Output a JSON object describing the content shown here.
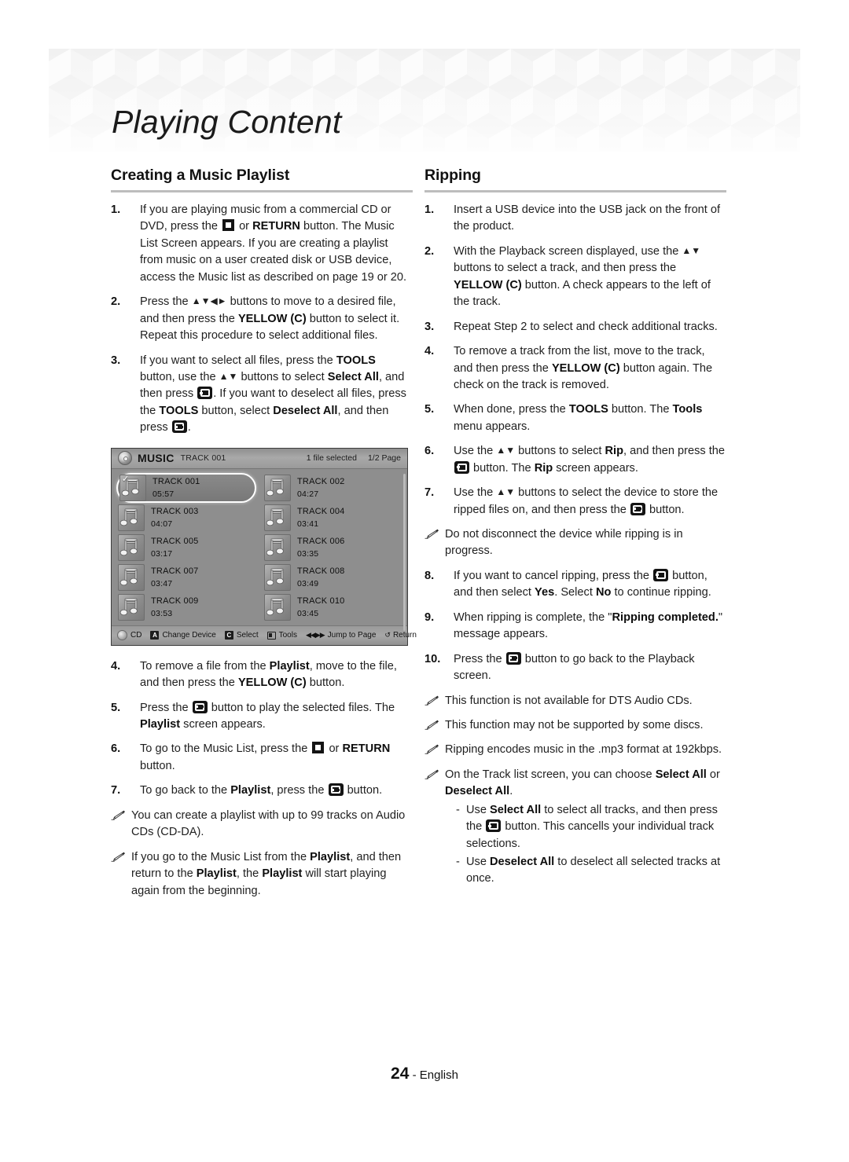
{
  "header": {
    "chapter_title": "Playing Content"
  },
  "left_column": {
    "section_title": "Creating a Music Playlist",
    "steps": [
      {
        "num": "1.",
        "html": "If you are playing music from a commercial CD or DVD, press the <span class=\"key-stop\" data-name=\"stop-key-icon\" data-interactable=\"false\"></span> or <b>RETURN</b> button. The Music List Screen appears. If you are creating a playlist from music on a user created disk or USB device, access the Music list as described on page 19 or 20."
      },
      {
        "num": "2.",
        "html": "Press the <span class=\"arrows\">&#9650;&#9660;&#9664;&#9658;</span> buttons to move to a desired file, and then press the <b>YELLOW (C)</b> button to select it. Repeat this procedure to select additional files."
      },
      {
        "num": "3.",
        "html": "If you want to select all files, press the <b>TOOLS</b> button, use the <span class=\"arrows\">&#9650;&#9660;</span> buttons to select <b>Select All</b>, and then press <span class=\"key-enter\" data-name=\"enter-key-icon\" data-interactable=\"false\"></span>. If you want to deselect all files, press the <b>TOOLS</b> button, select <b>Deselect All</b>, and then press <span class=\"key-enter\" data-name=\"enter-key-icon\" data-interactable=\"false\"></span>."
      }
    ],
    "steps_after": [
      {
        "num": "4.",
        "html": "To remove a file from the <b>Playlist</b>, move to the file, and then press the <b>YELLOW (C)</b> button."
      },
      {
        "num": "5.",
        "html": "Press the <span class=\"key-enter\" data-name=\"enter-key-icon\" data-interactable=\"false\"></span> button to play the selected files. The <b>Playlist</b> screen appears."
      },
      {
        "num": "6.",
        "html": "To go to the Music List, press the <span class=\"key-stop\" data-name=\"stop-key-icon\" data-interactable=\"false\"></span> or <b>RETURN</b> button."
      },
      {
        "num": "7.",
        "html": "To go back to the <b>Playlist</b>, press the <span class=\"key-enter\" data-name=\"enter-key-icon\" data-interactable=\"false\"></span> button."
      }
    ],
    "notes": [
      {
        "html": "You can create a playlist with up to 99 tracks on Audio CDs (CD-DA)."
      },
      {
        "html": "If you go to the Music List from the <b>Playlist</b>, and then return to the <b>Playlist</b>, the <b>Playlist</b> will start playing again from the beginning."
      }
    ]
  },
  "screen": {
    "disc_icon": "disc-icon",
    "title": "MUSIC",
    "subtitle": "TRACK 001",
    "selected_count": "1 file selected",
    "page_indicator": "1/2 Page",
    "tracks": [
      {
        "name": "TRACK 001",
        "time": "05:57",
        "selected": true,
        "checked": true
      },
      {
        "name": "TRACK 002",
        "time": "04:27",
        "selected": false,
        "checked": false
      },
      {
        "name": "TRACK 003",
        "time": "04:07",
        "selected": false,
        "checked": false
      },
      {
        "name": "TRACK 004",
        "time": "03:41",
        "selected": false,
        "checked": false
      },
      {
        "name": "TRACK 005",
        "time": "03:17",
        "selected": false,
        "checked": false
      },
      {
        "name": "TRACK 006",
        "time": "03:35",
        "selected": false,
        "checked": false
      },
      {
        "name": "TRACK 007",
        "time": "03:47",
        "selected": false,
        "checked": false
      },
      {
        "name": "TRACK 008",
        "time": "03:49",
        "selected": false,
        "checked": false
      },
      {
        "name": "TRACK 009",
        "time": "03:53",
        "selected": false,
        "checked": false
      },
      {
        "name": "TRACK 010",
        "time": "03:45",
        "selected": false,
        "checked": false
      }
    ],
    "footer_items": [
      {
        "icon": "disc-icon",
        "badge": "",
        "label": "CD"
      },
      {
        "icon": "red-a-key-icon",
        "badge": "A",
        "label": "Change Device"
      },
      {
        "icon": "yellow-c-key-icon",
        "badge": "C",
        "label": "Select"
      },
      {
        "icon": "tools-key-icon",
        "badge": "",
        "label": "Tools"
      },
      {
        "icon": "skip-keys-icon",
        "badge": "",
        "label": "Jump to Page"
      },
      {
        "icon": "return-key-icon",
        "badge": "",
        "label": "Return"
      }
    ]
  },
  "right_column": {
    "section_title": "Ripping",
    "steps": [
      {
        "num": "1.",
        "html": "Insert a USB device into the USB jack on the front of the product."
      },
      {
        "num": "2.",
        "html": "With the Playback screen displayed, use the <span class=\"arrows\">&#9650;&#9660;</span> buttons to select a track, and then press the <b>YELLOW (C)</b> button. A check appears to the left of the track."
      },
      {
        "num": "3.",
        "html": "Repeat Step 2 to select and check additional tracks."
      },
      {
        "num": "4.",
        "html": "To remove a track from the list, move to the track, and then press the <b>YELLOW (C)</b> button again. The check on the track is removed."
      },
      {
        "num": "5.",
        "html": "When done, press the <b>TOOLS</b> button. The <b>Tools</b> menu appears."
      },
      {
        "num": "6.",
        "html": "Use the <span class=\"arrows\">&#9650;&#9660;</span> buttons to select <b>Rip</b>, and then press the <span class=\"key-enter\" data-name=\"enter-key-icon\" data-interactable=\"false\"></span> button. The <b>Rip</b> screen appears."
      },
      {
        "num": "7.",
        "html": "Use the <span class=\"arrows\">&#9650;&#9660;</span> buttons to select the device to store the ripped files on, and then press the <span class=\"key-enter\" data-name=\"enter-key-icon\" data-interactable=\"false\"></span> button."
      }
    ],
    "mid_note": {
      "html": "Do not disconnect the device while ripping is in progress."
    },
    "steps2": [
      {
        "num": "8.",
        "html": "If you want to cancel ripping, press the <span class=\"key-enter\" data-name=\"enter-key-icon\" data-interactable=\"false\"></span> button, and then select <b>Yes</b>. Select <b>No</b> to continue ripping."
      },
      {
        "num": "9.",
        "html": "When ripping is complete, the \"<b>Ripping completed.</b>\" message appears."
      },
      {
        "num": "10.",
        "html": "Press the <span class=\"key-enter\" data-name=\"enter-key-icon\" data-interactable=\"false\"></span> button to go back to the Playback screen."
      }
    ],
    "notes": [
      {
        "html": "This function is not available for DTS Audio CDs.",
        "subs": []
      },
      {
        "html": "This function may not be supported by some discs.",
        "subs": []
      },
      {
        "html": "Ripping encodes music in the .mp3 format at 192kbps.",
        "subs": []
      },
      {
        "html": "On the Track list screen, you can choose <b>Select All</b> or <b>Deselect All</b>.",
        "subs": [
          {
            "dash": "-",
            "html": "Use <b>Select All</b> to select all tracks, and then press the <span class=\"key-enter\" data-name=\"enter-key-icon\" data-interactable=\"false\"></span> button. This cancells your individual track selections."
          },
          {
            "dash": "-",
            "html": "Use <b>Deselect All</b> to deselect all selected tracks at once."
          }
        ]
      }
    ]
  },
  "footer": {
    "page_number": "24",
    "separator": " - ",
    "language": "English"
  }
}
